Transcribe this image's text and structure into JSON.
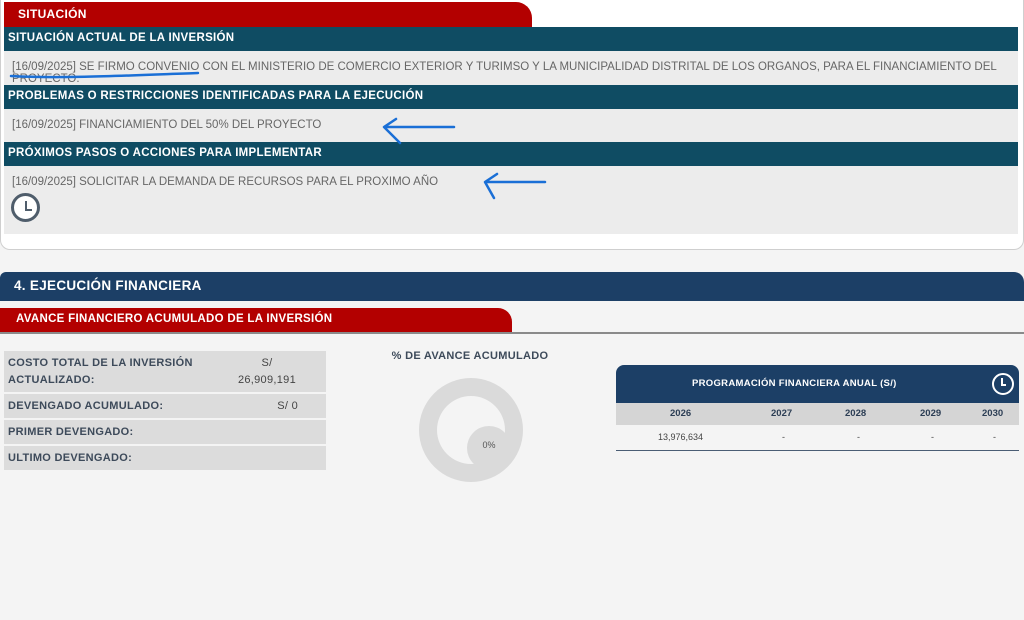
{
  "situacion": {
    "tab_label": "SITUACIÓN",
    "actual_header": "SITUACIÓN ACTUAL DE LA INVERSIÓN",
    "actual_text": "[16/09/2025] SE FIRMO CONVENIO CON EL MINISTERIO DE COMERCIO EXTERIOR Y TURIMSO Y LA MUNICIPALIDAD DISTRITAL DE LOS ORGANOS, PARA EL FINANCIAMIENTO DEL PROYECTO.",
    "problemas_header": "PROBLEMAS O RESTRICCIONES IDENTIFICADAS PARA LA EJECUCIÓN",
    "problemas_text": "[16/09/2025] FINANCIAMIENTO DEL 50% DEL PROYECTO",
    "pasos_header": "PRÓXIMOS PASOS O ACCIONES PARA IMPLEMENTAR",
    "pasos_text": "[16/09/2025] SOLICITAR LA DEMANDA DE RECURSOS PARA EL PROXIMO AÑO",
    "history_icon": "clock-icon"
  },
  "ejecucion": {
    "section_title": "4. EJECUCIÓN FINANCIERA",
    "avance_tab": "AVANCE FINANCIERO ACUMULADO DE LA INVERSIÓN",
    "summary": [
      {
        "label_line1": "COSTO TOTAL DE LA INVERSIÓN",
        "label_line2": "ACTUALIZADO:",
        "value_line1": "S/",
        "value_line2": "26,909,191"
      },
      {
        "label_line1": "DEVENGADO ACUMULADO:",
        "label_line2": "",
        "value_line1": "S/ 0",
        "value_line2": ""
      },
      {
        "label_line1": "PRIMER DEVENGADO:",
        "label_line2": "",
        "value_line1": "",
        "value_line2": ""
      },
      {
        "label_line1": "ULTIMO DEVENGADO:",
        "label_line2": "",
        "value_line1": "",
        "value_line2": ""
      }
    ],
    "donut_title": "% DE AVANCE ACUMULADO",
    "donut_value": "0%",
    "programacion": {
      "title": "PROGRAMACIÓN FINANCIERA ANUAL (S/)",
      "icon": "clock-icon",
      "years": [
        "2026",
        "2027",
        "2028",
        "2029",
        "2030"
      ],
      "values": [
        "13,976,634",
        "-",
        "-",
        "-",
        "-"
      ]
    }
  },
  "colors": {
    "red_tab": "#b30000",
    "teal_header": "#0f4c63",
    "navy_header": "#1c3f66"
  }
}
